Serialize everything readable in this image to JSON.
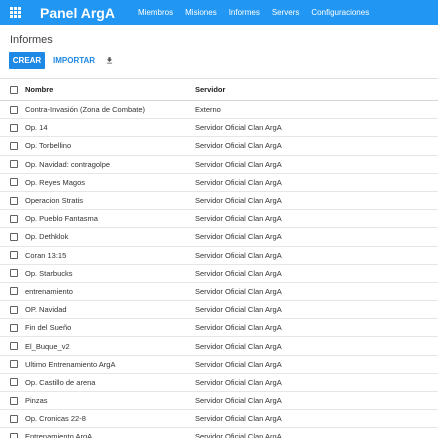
{
  "app": {
    "title": "Panel ArgA"
  },
  "nav": {
    "items": [
      "Miembros",
      "Misiones",
      "Informes",
      "Servers",
      "Configuraciones"
    ]
  },
  "page": {
    "title": "Informes"
  },
  "toolbar": {
    "create_label": "CREAR",
    "import_label": "IMPORTAR",
    "download_icon": "download-icon"
  },
  "table": {
    "columns": [
      "Nombre",
      "Servidor"
    ],
    "rows": [
      {
        "name": "Contra-Invasión (Zona de Combate)",
        "server": "Externo"
      },
      {
        "name": "Op. 14",
        "server": "Servidor Oficial Clan ArgA"
      },
      {
        "name": "Op. Torbellino",
        "server": "Servidor Oficial Clan ArgA"
      },
      {
        "name": "Op. Navidad: contragolpe",
        "server": "Servidor Oficial Clan ArgA"
      },
      {
        "name": "Op. Reyes Magos",
        "server": "Servidor Oficial Clan ArgA"
      },
      {
        "name": "Operacion Stratis",
        "server": "Servidor Oficial Clan ArgA"
      },
      {
        "name": "Op. Pueblo Fantasma",
        "server": "Servidor Oficial Clan ArgA"
      },
      {
        "name": "Op. Dethklok",
        "server": "Servidor Oficial Clan ArgA"
      },
      {
        "name": "Coran 13:15",
        "server": "Servidor Oficial Clan ArgA"
      },
      {
        "name": "Op. Starbucks",
        "server": "Servidor Oficial Clan ArgA"
      },
      {
        "name": "entrenamiento",
        "server": "Servidor Oficial Clan ArgA"
      },
      {
        "name": "OP. Navidad",
        "server": "Servidor Oficial Clan ArgA"
      },
      {
        "name": "Fin del Sueño",
        "server": "Servidor Oficial Clan ArgA"
      },
      {
        "name": "El_Buque_v2",
        "server": "Servidor Oficial Clan ArgA"
      },
      {
        "name": "Ultimo Entrenamiento ArgA",
        "server": "Servidor Oficial Clan ArgA"
      },
      {
        "name": "Op. Castillo de arena",
        "server": "Servidor Oficial Clan ArgA"
      },
      {
        "name": "Pinzas",
        "server": "Servidor Oficial Clan ArgA"
      },
      {
        "name": "Op. Cronicas 22-8",
        "server": "Servidor Oficial Clan ArgA"
      },
      {
        "name": "Entrenamiento ArgA",
        "server": "Servidor Oficial Clan ArgA"
      }
    ]
  },
  "colors": {
    "accent": "#2196f3",
    "button": "#1e88e5"
  }
}
